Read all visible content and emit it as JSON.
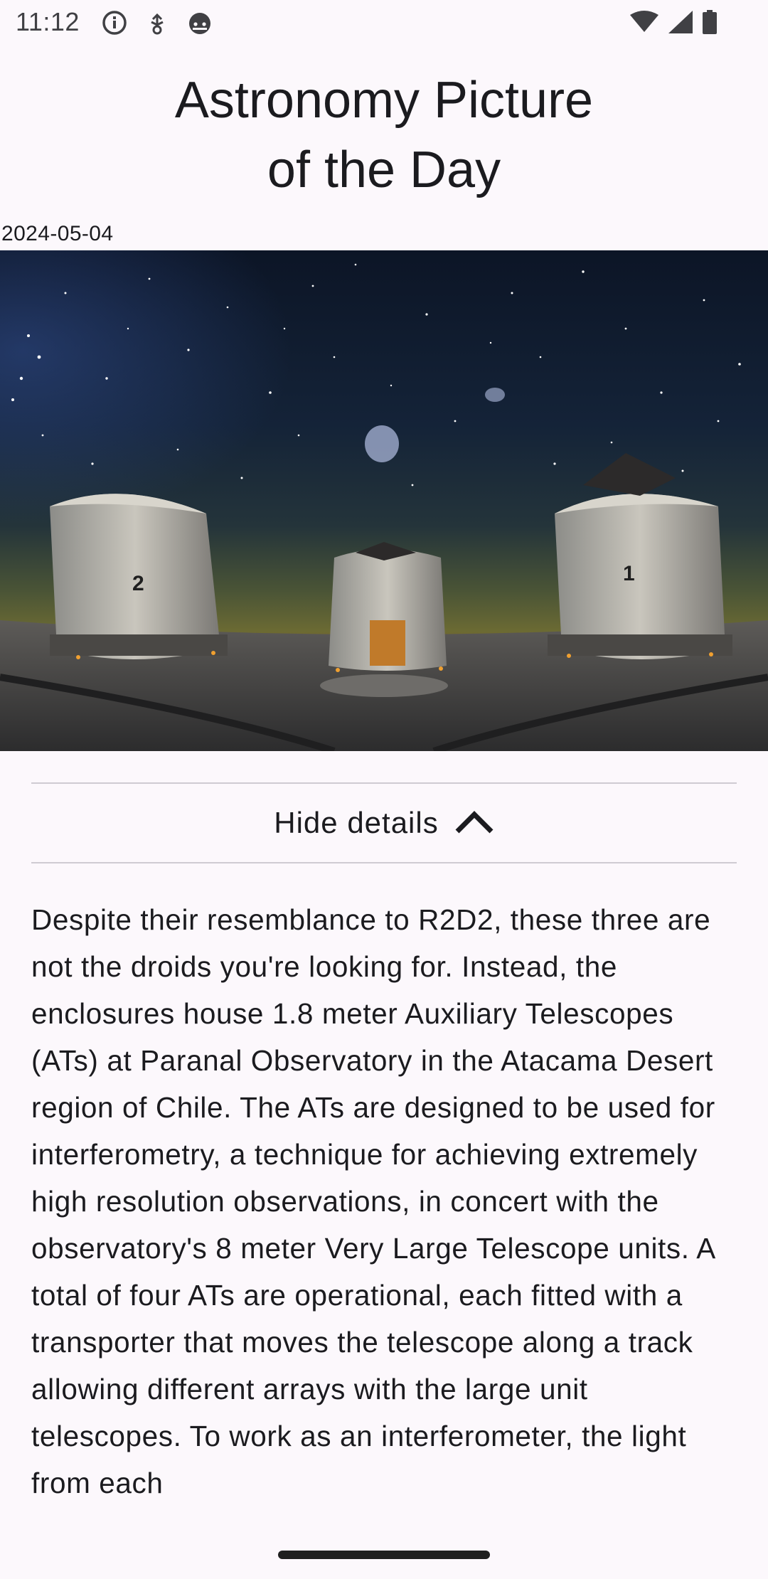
{
  "status_bar": {
    "time": "11:12",
    "left_icons": [
      "info-icon",
      "usb-debug-icon",
      "android-face-icon"
    ],
    "right_icons": [
      "wifi-icon",
      "cellular-signal-icon",
      "battery-icon"
    ]
  },
  "header": {
    "title_line1": "Astronomy Picture",
    "title_line2": "of the Day"
  },
  "apod": {
    "date": "2024-05-04",
    "image_subject": "telescope-enclosures-under-night-sky",
    "image_numbers": [
      "2",
      "1"
    ],
    "details_toggle_label": "Hide details",
    "details_toggle_icon": "chevron-up-icon",
    "explanation": "Despite their resemblance to R2D2, these three are not the droids you're looking for. Instead, the enclosures house 1.8 meter Auxiliary Telescopes (ATs) at Paranal Observatory in the Atacama Desert region of Chile. The ATs are designed to be used for interferometry, a technique for achieving extremely high resolution observations, in concert with the observatory's 8 meter Very Large Telescope units. A total of four ATs are operational, each fitted with a transporter that moves the telescope along a track allowing different arrays with the large unit telescopes. To work as an interferometer, the light from each"
  },
  "colors": {
    "background": "#fcf8fc",
    "text": "#1b1b1f",
    "divider": "#cfcbd2",
    "sky_top": "#0c1526",
    "horizon_glow": "#6b6a33"
  }
}
